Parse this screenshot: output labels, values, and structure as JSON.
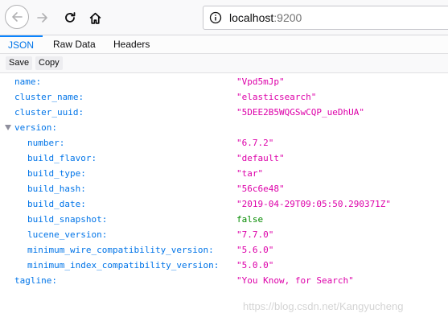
{
  "browser": {
    "url_host": "localhost",
    "url_port": ":9200"
  },
  "tabs": [
    "JSON",
    "Raw Data",
    "Headers"
  ],
  "toolbar": {
    "save_label": "Save",
    "copy_label": "Copy"
  },
  "json_tree": [
    {
      "key": "name:",
      "value": "\"Vpd5mJp\"",
      "type": "str",
      "level": 0
    },
    {
      "key": "cluster_name:",
      "value": "\"elasticsearch\"",
      "type": "str",
      "level": 0
    },
    {
      "key": "cluster_uuid:",
      "value": "\"5DEE2B5WQGSwCQP_ueDhUA\"",
      "type": "str",
      "level": 0
    },
    {
      "key": "version:",
      "value": "",
      "type": "obj",
      "level": 0
    },
    {
      "key": "number:",
      "value": "\"6.7.2\"",
      "type": "str",
      "level": 1
    },
    {
      "key": "build_flavor:",
      "value": "\"default\"",
      "type": "str",
      "level": 1
    },
    {
      "key": "build_type:",
      "value": "\"tar\"",
      "type": "str",
      "level": 1
    },
    {
      "key": "build_hash:",
      "value": "\"56c6e48\"",
      "type": "str",
      "level": 1
    },
    {
      "key": "build_date:",
      "value": "\"2019-04-29T09:05:50.290371Z\"",
      "type": "str",
      "level": 1
    },
    {
      "key": "build_snapshot:",
      "value": "false",
      "type": "bool",
      "level": 1
    },
    {
      "key": "lucene_version:",
      "value": "\"7.7.0\"",
      "type": "str",
      "level": 1
    },
    {
      "key": "minimum_wire_compatibility_version:",
      "value": "\"5.6.0\"",
      "type": "str",
      "level": 1
    },
    {
      "key": "minimum_index_compatibility_version:",
      "value": "\"5.0.0\"",
      "type": "str",
      "level": 1
    },
    {
      "key": "tagline:",
      "value": "\"You Know, for Search\"",
      "type": "str",
      "level": 0
    }
  ],
  "watermark": "https://blog.csdn.net/Kangyucheng"
}
